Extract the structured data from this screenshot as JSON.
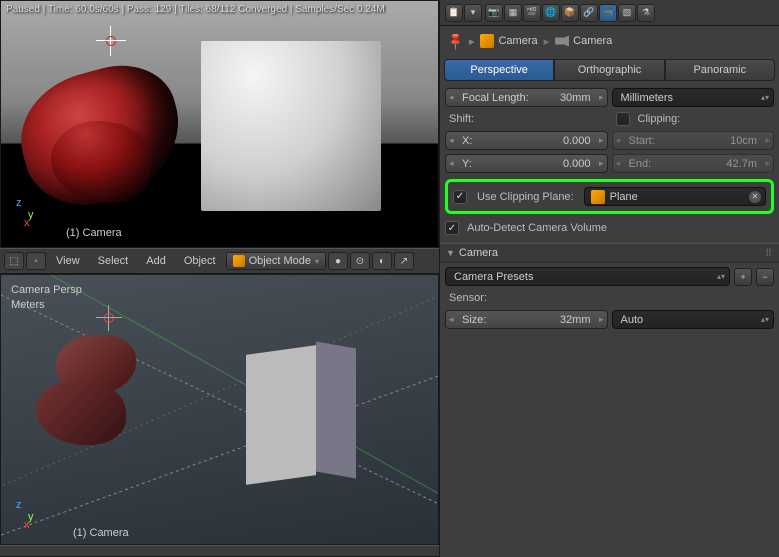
{
  "render": {
    "status": "Paused | Time: 60.0s/60s | Pass: 129 | Tiles: 68/112 Converged | Samples/Sec 0.24M",
    "camera_label": "(1) Camera"
  },
  "viewport": {
    "persp_label": "Camera Persp",
    "units_label": "Meters",
    "camera_label": "(1) Camera"
  },
  "menubar": {
    "view": "View",
    "select": "Select",
    "add": "Add",
    "object": "Object",
    "mode": "Object Mode"
  },
  "breadcrumb": {
    "item1": "Camera",
    "item2": "Camera"
  },
  "tabs": {
    "perspective": "Perspective",
    "orthographic": "Orthographic",
    "panoramic": "Panoramic"
  },
  "lens": {
    "focal_label": "Focal Length:",
    "focal_value": "30mm",
    "units_value": "Millimeters",
    "shift_label": "Shift:",
    "clipping_label": "Clipping:",
    "x_label": "X:",
    "x_value": "0.000",
    "y_label": "Y:",
    "y_value": "0.000",
    "start_label": "Start:",
    "start_value": "10cm",
    "end_label": "End:",
    "end_value": "42.7m",
    "use_clipping": "Use Clipping Plane:",
    "clipping_obj": "Plane",
    "autodetect": "Auto-Detect Camera Volume"
  },
  "camera_panel": {
    "title": "Camera",
    "presets_label": "Camera Presets",
    "sensor_label": "Sensor:",
    "size_label": "Size:",
    "size_value": "32mm",
    "fit_value": "Auto"
  }
}
